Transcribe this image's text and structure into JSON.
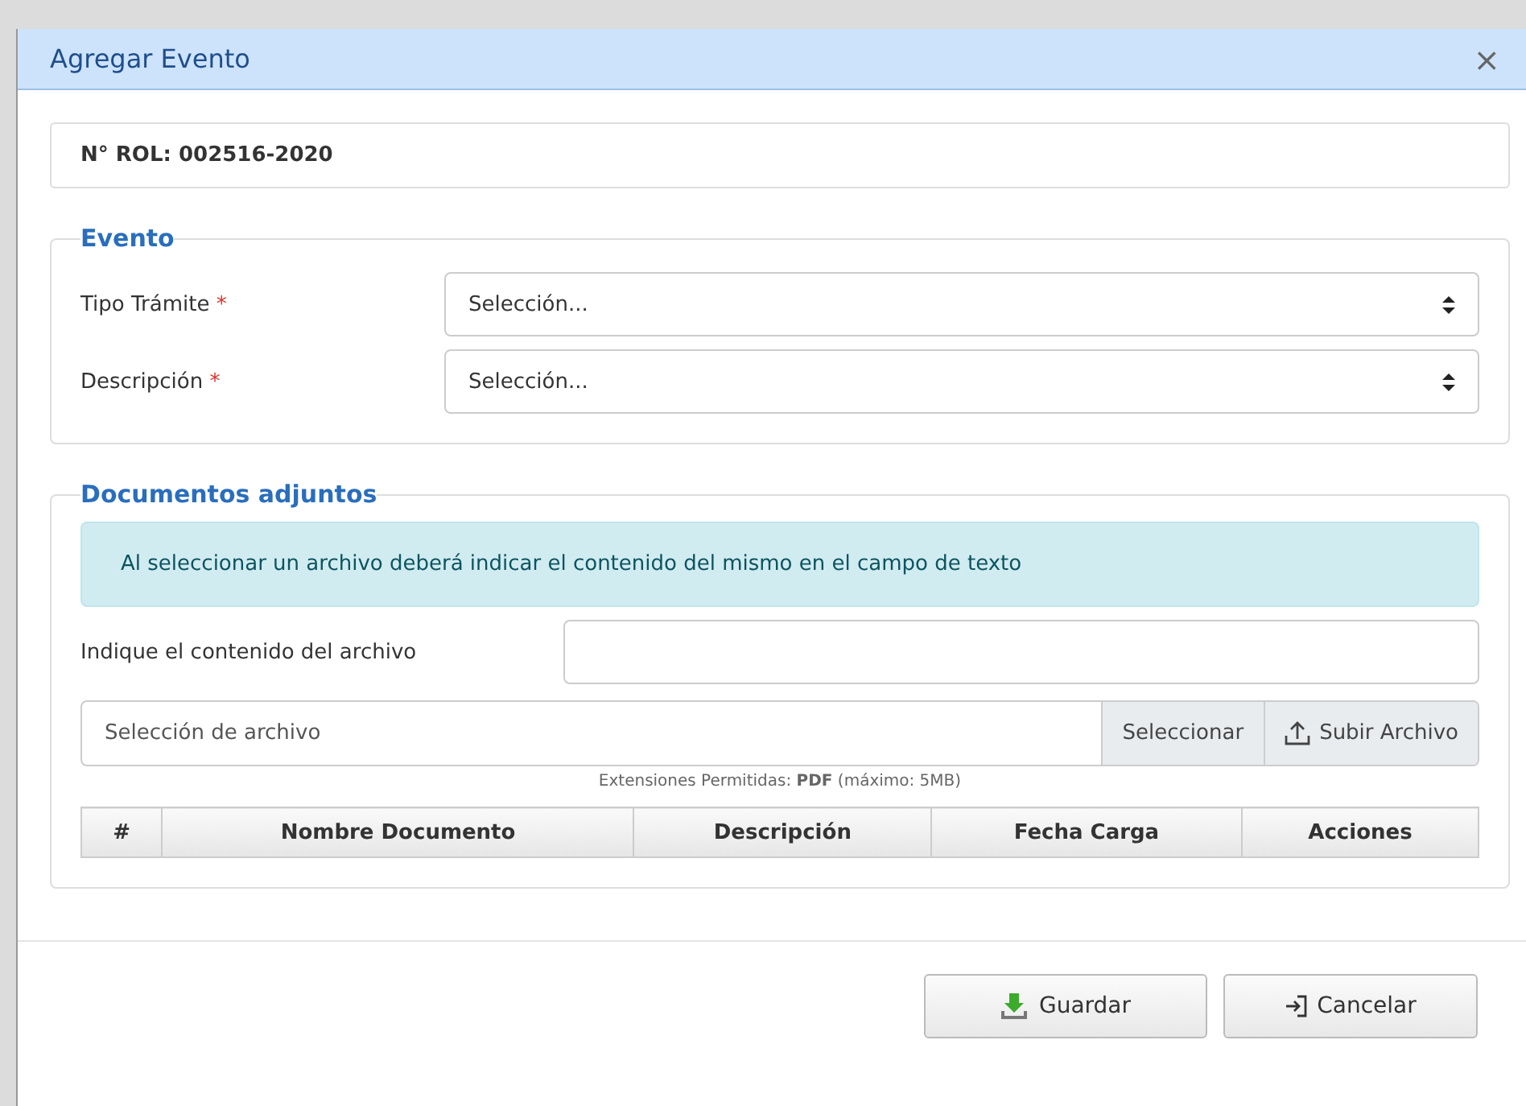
{
  "dialog": {
    "title": "Agregar Evento",
    "close": "×"
  },
  "rol": "N° ROL: 002516-2020",
  "evento": {
    "legend": "Evento",
    "fields": [
      {
        "label": "Tipo Trámite",
        "required_mark": "*",
        "value": "Selección..."
      },
      {
        "label": "Descripción",
        "required_mark": "*",
        "value": "Selección..."
      }
    ]
  },
  "documentos": {
    "legend": "Documentos adjuntos",
    "alert": "Al seleccionar un archivo deberá indicar el contenido del mismo en el campo de texto",
    "content_label": "Indique el contenido del archivo",
    "file_placeholder": "Selección de archivo",
    "select_button": "Seleccionar",
    "upload_button": "Subir Archivo",
    "note": "Extensiones Permitidas: **PDF** (máximo: 5MB)",
    "table": {
      "columns": [
        "#",
        "Nombre Documento",
        "Descripción",
        "Fecha Carga",
        "Acciones"
      ]
    }
  },
  "footer": {
    "buttons": [
      {
        "kind": "save",
        "label": "Guardar"
      },
      {
        "kind": "cancel",
        "label": "Cancelar"
      }
    ]
  }
}
